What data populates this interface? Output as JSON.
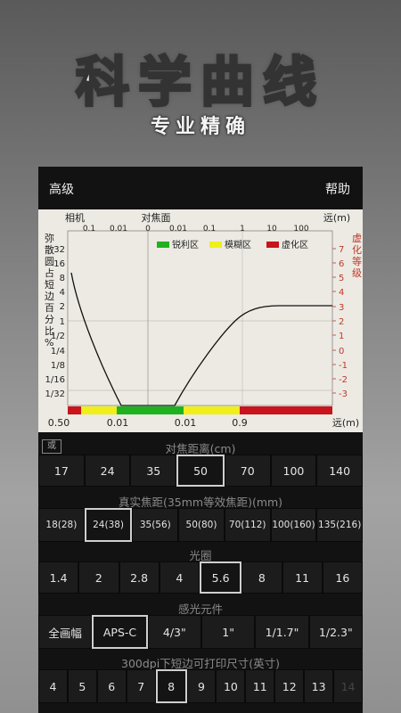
{
  "hero": {
    "title": "科学曲线",
    "subtitle": "专业精确"
  },
  "topbar": {
    "advanced_label": "高级",
    "help_label": "帮助"
  },
  "chart_labels": {
    "camera": "相机",
    "focus_plane": "对焦面",
    "far": "远(m)",
    "far_bottom": "远(m)",
    "left_axis": [
      "弥",
      "散",
      "圆",
      "占",
      "短",
      "边",
      "百",
      "分",
      "比",
      "%"
    ],
    "right_axis": [
      "虚",
      "化",
      "等",
      "级"
    ],
    "top_ticks": [
      "0.1",
      "0.01",
      "0",
      "0.01",
      "0.1",
      "1",
      "10",
      "100"
    ],
    "left_ticks": [
      "32",
      "16",
      "8",
      "4",
      "2",
      "1",
      "1/2",
      "1/4",
      "1/8",
      "1/16",
      "1/32"
    ],
    "right_ticks": [
      "7",
      "6",
      "5",
      "4",
      "3",
      "2",
      "1",
      "0",
      "-1",
      "-2",
      "-3"
    ],
    "bottom_ticks": [
      "0.50",
      "0.01",
      "0.01",
      "0.9"
    ],
    "legend": [
      {
        "label": "锐利区",
        "color": "#1fb21f"
      },
      {
        "label": "模糊区",
        "color": "#f0ef1a"
      },
      {
        "label": "虚化区",
        "color": "#c8141b"
      }
    ]
  },
  "or_badge": "或",
  "sections": {
    "focus_distance": {
      "title": "对焦距离(cm)",
      "options": [
        "17",
        "24",
        "35",
        "50",
        "70",
        "100",
        "140"
      ],
      "selected": "50"
    },
    "focal_length": {
      "title": "真实焦距(35mm等效焦距)(mm)",
      "options": [
        "18(28)",
        "24(38)",
        "35(56)",
        "50(80)",
        "70(112)",
        "100(160)",
        "135(216)"
      ],
      "selected": "24(38)"
    },
    "aperture": {
      "title": "光圈",
      "options": [
        "1.4",
        "2",
        "2.8",
        "4",
        "5.6",
        "8",
        "11",
        "16"
      ],
      "selected": "5.6"
    },
    "sensor": {
      "title": "感光元件",
      "options": [
        "全画幅",
        "APS-C",
        "4/3\"",
        "1\"",
        "1/1.7\"",
        "1/2.3\""
      ],
      "selected": "APS-C"
    },
    "print_size": {
      "title": "300dpi下短边可打印尺寸(英寸)",
      "options": [
        "4",
        "5",
        "6",
        "7",
        "8",
        "9",
        "10",
        "11",
        "12",
        "13",
        "14"
      ],
      "selected": "8"
    }
  }
}
